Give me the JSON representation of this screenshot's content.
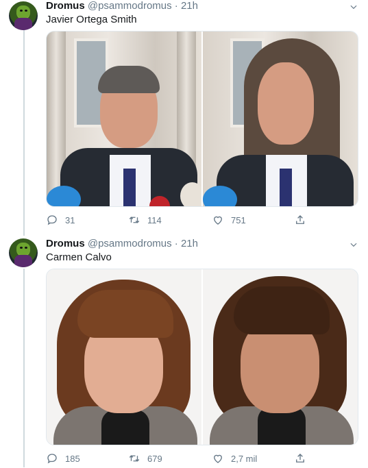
{
  "tweets": [
    {
      "author_name": "Dromus",
      "handle": "@psammodromus",
      "separator": "·",
      "time": "21h",
      "text": "Javier Ortega Smith",
      "actions": {
        "reply_count": "31",
        "retweet_count": "114",
        "like_count": "751"
      }
    },
    {
      "author_name": "Dromus",
      "handle": "@psammodromus",
      "separator": "·",
      "time": "21h",
      "text": "Carmen Calvo",
      "actions": {
        "reply_count": "185",
        "retweet_count": "679",
        "like_count": "2,7 mil"
      }
    }
  ],
  "icons": {
    "reply": "reply-icon",
    "retweet": "retweet-icon",
    "like": "heart-icon",
    "share": "share-icon",
    "more": "chevron-down-icon"
  },
  "colors": {
    "text_primary": "#14171a",
    "text_secondary": "#657786",
    "divider": "#e1e8ed",
    "thread_line": "#cfd9de"
  }
}
